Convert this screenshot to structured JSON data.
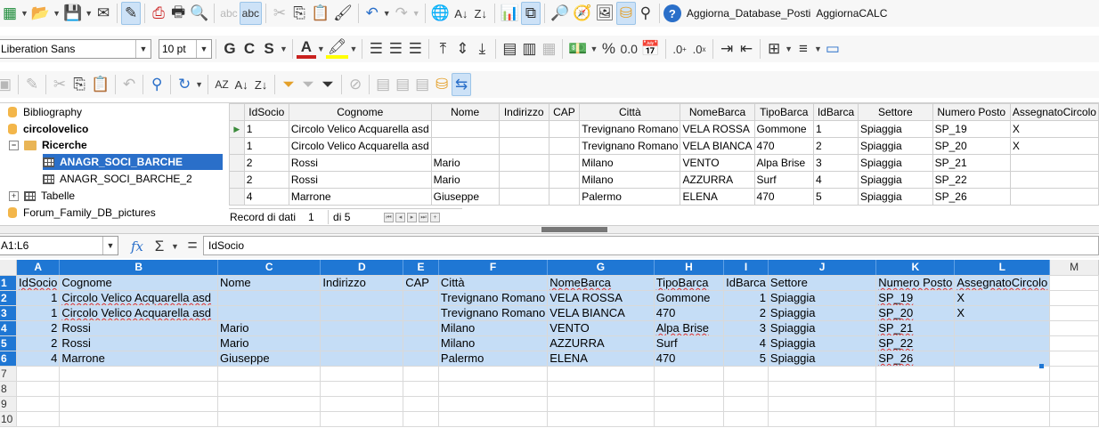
{
  "toolbar1": {
    "macro1": "Aggiorna_Database_Posti",
    "macro2": "AggiornaCALC"
  },
  "toolbar2": {
    "font_name": "Liberation Sans",
    "font_size": "10 pt",
    "bold": "G",
    "italic": "C",
    "strike": "S"
  },
  "tree": {
    "items": [
      {
        "label": "Bibliography"
      },
      {
        "label": "circolovelico"
      },
      {
        "label": "Ricerche"
      },
      {
        "label": "ANAGR_SOCI_BARCHE"
      },
      {
        "label": "ANAGR_SOCI_BARCHE_2"
      },
      {
        "label": "Tabelle"
      },
      {
        "label": "Forum_Family_DB_pictures"
      }
    ]
  },
  "dbgrid": {
    "columns": [
      "IdSocio",
      "Cognome",
      "Nome",
      "Indirizzo",
      "CAP",
      "Città",
      "NomeBarca",
      "TipoBarca",
      "IdBarca",
      "Settore",
      "Numero Posto",
      "AssegnatoCircolo"
    ],
    "rows": [
      [
        "1",
        "Circolo Velico Acquarella asd",
        "",
        "",
        "",
        "Trevignano Romano",
        "VELA ROSSA",
        "Gommone",
        "1",
        "Spiaggia",
        "SP_19",
        "X"
      ],
      [
        "1",
        "Circolo Velico Acquarella asd",
        "",
        "",
        "",
        "Trevignano Romano",
        "VELA BIANCA",
        "470",
        "2",
        "Spiaggia",
        "SP_20",
        "X"
      ],
      [
        "2",
        "Rossi",
        "Mario",
        "",
        "",
        "Milano",
        "VENTO",
        "Alpa Brise",
        "3",
        "Spiaggia",
        "SP_21",
        ""
      ],
      [
        "2",
        "Rossi",
        "Mario",
        "",
        "",
        "Milano",
        "AZZURRA",
        "Surf",
        "4",
        "Spiaggia",
        "SP_22",
        ""
      ],
      [
        "4",
        "Marrone",
        "Giuseppe",
        "",
        "",
        "Palermo",
        "ELENA",
        "470",
        "5",
        "Spiaggia",
        "SP_26",
        ""
      ]
    ],
    "nav_label": "Record di dati",
    "nav_record": "1",
    "nav_of": "di 5"
  },
  "formula": {
    "cell_ref": "A1:L6",
    "content": "IdSocio"
  },
  "sheet": {
    "col_letters": [
      "A",
      "B",
      "C",
      "D",
      "E",
      "F",
      "G",
      "H",
      "I",
      "J",
      "K",
      "L",
      "M"
    ],
    "row_numbers": [
      "1",
      "2",
      "3",
      "4",
      "5",
      "6",
      "7",
      "8",
      "9",
      "10"
    ],
    "header": [
      "IdSocio",
      "Cognome",
      "Nome",
      "Indirizzo",
      "CAP",
      "Città",
      "NomeBarca",
      "TipoBarca",
      "IdBarca",
      "Settore",
      "Numero Posto",
      "AssegnatoCircolo"
    ],
    "rows": [
      [
        "1",
        "Circolo Velico Acquarella asd",
        "",
        "",
        "",
        "Trevignano Romano",
        "VELA ROSSA",
        "Gommone",
        "1",
        "Spiaggia",
        "SP_19",
        "X"
      ],
      [
        "1",
        "Circolo Velico Acquarella asd",
        "",
        "",
        "",
        "Trevignano Romano",
        "VELA BIANCA",
        "470",
        "2",
        "Spiaggia",
        "SP_20",
        "X"
      ],
      [
        "2",
        "Rossi",
        "Mario",
        "",
        "",
        "Milano",
        "VENTO",
        "Alpa Brise",
        "3",
        "Spiaggia",
        "SP_21",
        ""
      ],
      [
        "2",
        "Rossi",
        "Mario",
        "",
        "",
        "Milano",
        "AZZURRA",
        "Surf",
        "4",
        "Spiaggia",
        "SP_22",
        ""
      ],
      [
        "4",
        "Marrone",
        "Giuseppe",
        "",
        "",
        "Palermo",
        "ELENA",
        "470",
        "5",
        "Spiaggia",
        "SP_26",
        ""
      ]
    ]
  }
}
